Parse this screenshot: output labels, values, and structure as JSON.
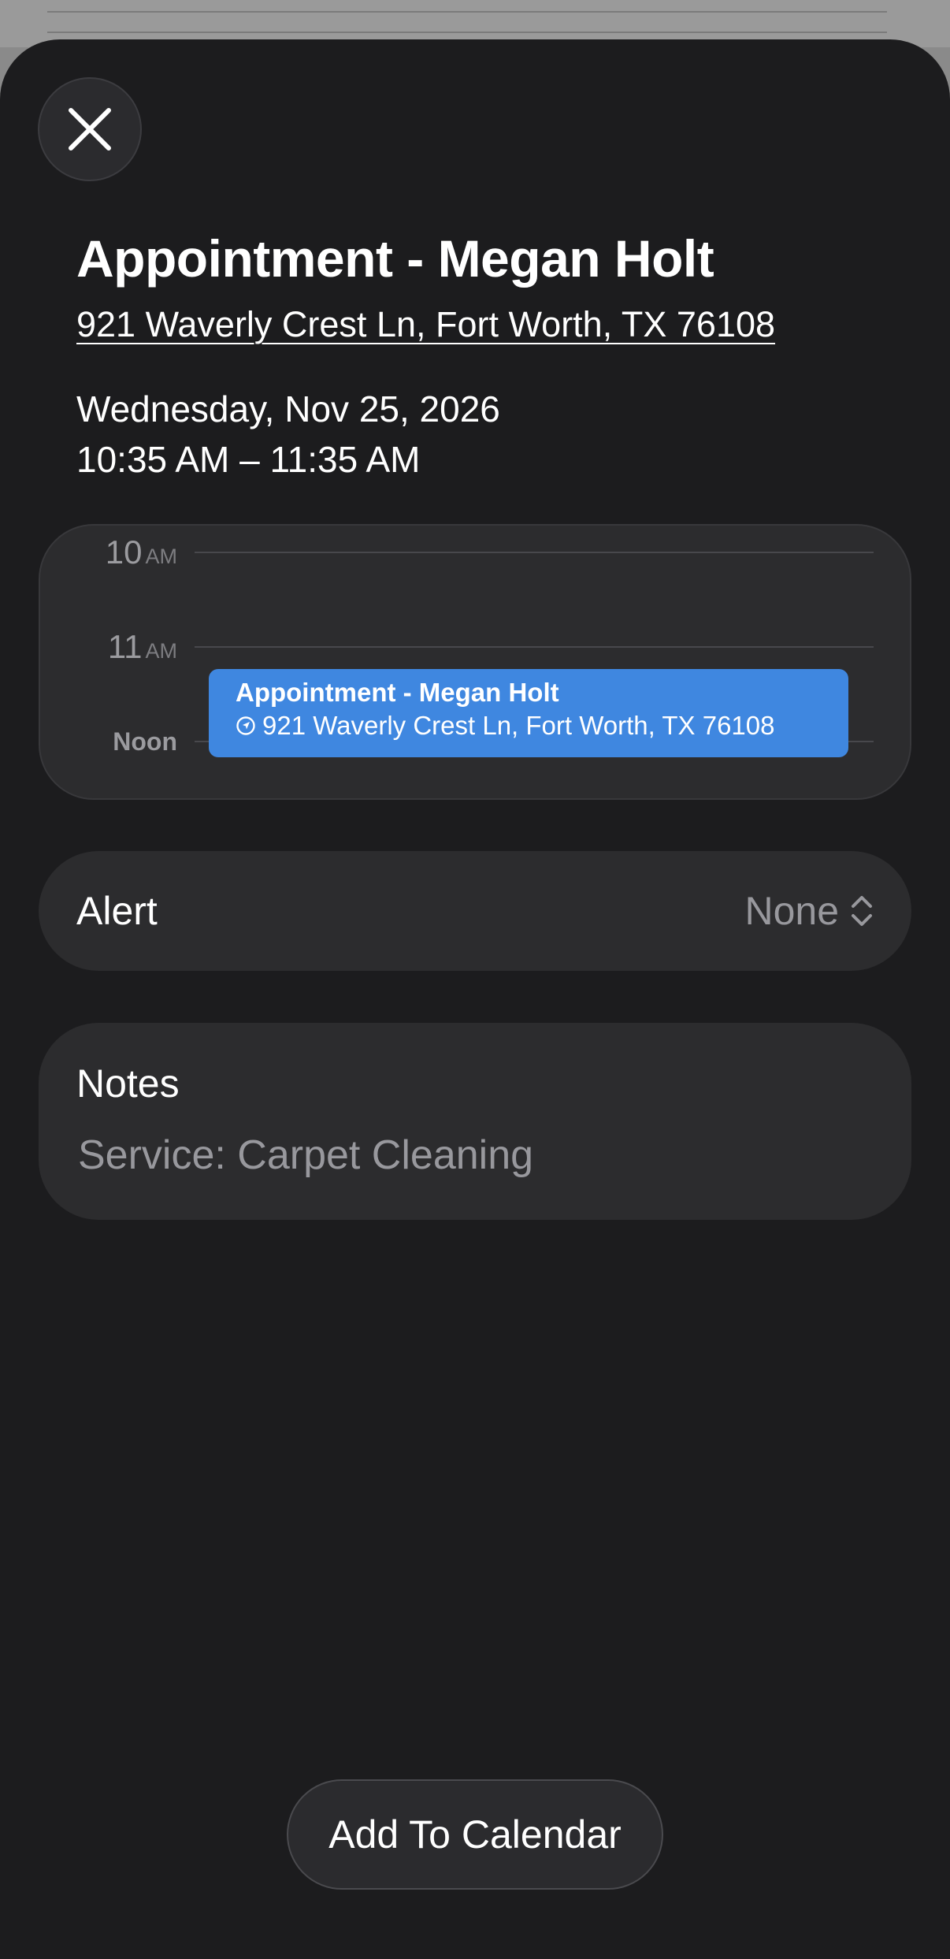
{
  "event": {
    "title": "Appointment - Megan Holt",
    "address": "921 Waverly Crest Ln, Fort Worth, TX 76108",
    "date": "Wednesday, Nov 25, 2026",
    "time_range": "10:35 AM – 11:35 AM"
  },
  "timeline": {
    "hours": [
      {
        "num": "10",
        "ampm": "AM"
      },
      {
        "num": "11",
        "ampm": "AM"
      }
    ],
    "noon_label": "Noon",
    "block": {
      "title": "Appointment - Megan Holt",
      "address": "921 Waverly Crest Ln, Fort Worth, TX 76108",
      "color": "#3f87e0"
    }
  },
  "alert": {
    "label": "Alert",
    "value": "None"
  },
  "notes": {
    "label": "Notes",
    "text": "Service: Carpet Cleaning"
  },
  "actions": {
    "add_to_calendar": "Add To Calendar"
  },
  "icons": {
    "close": "close-icon",
    "location": "location-arrow-icon",
    "chevron": "chevron-up-down-icon"
  },
  "colors": {
    "sheet_bg": "#1c1c1e",
    "card_bg": "#2c2c2e",
    "secondary_text": "#98989d",
    "event_blue": "#3f87e0"
  }
}
